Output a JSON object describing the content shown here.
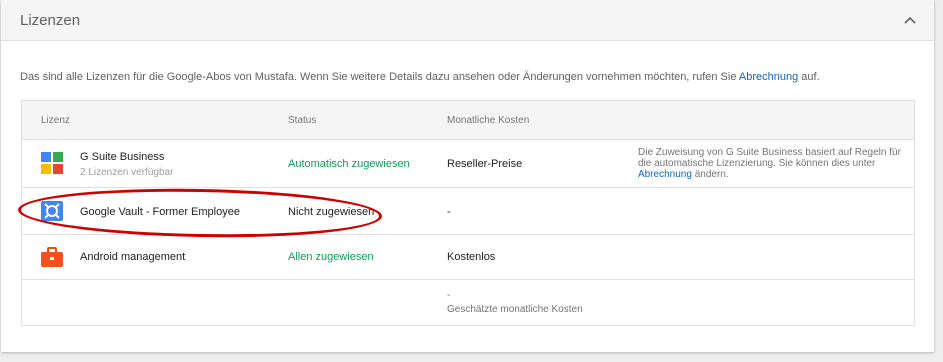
{
  "card": {
    "title": "Lizenzen"
  },
  "intro": {
    "text": "Das sind alle Lizenzen für die Google-Abos von Mustafa. Wenn Sie weitere Details dazu ansehen oder Änderungen vornehmen möchten, rufen Sie ",
    "link": "Abrechnung",
    "suffix": " auf."
  },
  "table": {
    "headers": {
      "license": "Lizenz",
      "status": "Status",
      "cost": "Monatliche Kosten"
    },
    "rows": [
      {
        "name": "G Suite Business",
        "sub": "2 Lizenzen verfügbar",
        "status": "Automatisch zugewiesen",
        "cost": "Reseller-Preise",
        "note_text": "Die Zuweisung von G Suite Business basiert auf Regeln für die automatische Lizenzierung. Sie können dies unter ",
        "note_link": "Abrechnung",
        "note_suffix": " ändern.",
        "icon": "g-suite-icon"
      },
      {
        "name": "Google Vault - Former Employee",
        "status": "Nicht zugewiesen",
        "cost": "-",
        "icon": "google-vault-icon"
      },
      {
        "name": "Android management",
        "status": "Allen zugewiesen",
        "cost": "Kostenlos",
        "icon": "briefcase-icon"
      }
    ],
    "footer": {
      "dash": "-",
      "label": "Geschätzte monatliche Kosten"
    }
  },
  "colors": {
    "accent_link": "#1565c0",
    "status_green": "#0f9d58",
    "annotation_red": "#d00000"
  }
}
